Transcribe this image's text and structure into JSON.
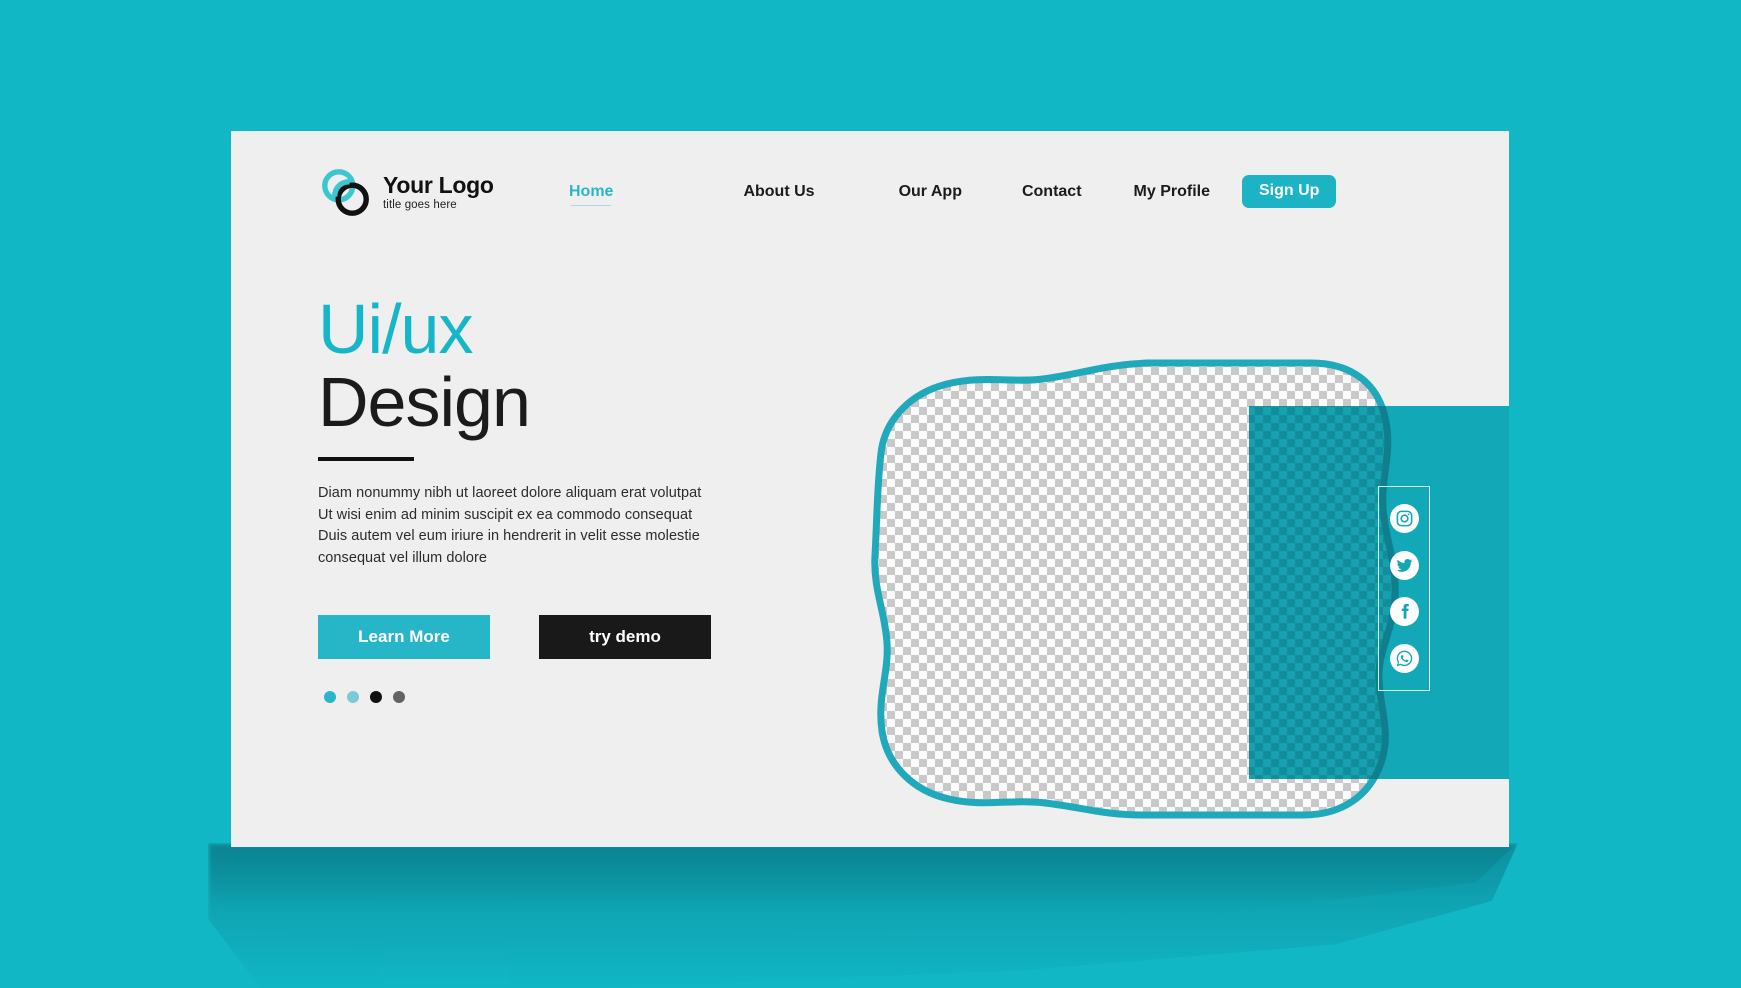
{
  "theme": {
    "page_bg": "#12b7c6",
    "card_bg": "#efefef",
    "accent": "#1cb3c4",
    "accent_light": "#2ab6c8",
    "panel_teal": "#13a8b7",
    "dark": "#191919"
  },
  "logo": {
    "title": "Your Logo",
    "tagline": "title goes here",
    "icon": "interlocking-loops-logo-icon",
    "colors": {
      "loop_teal": "#3cc6cf",
      "loop_dark": "#111111"
    }
  },
  "nav": {
    "items": [
      {
        "label": "Home",
        "active": true
      },
      {
        "label": "About Us",
        "active": false
      },
      {
        "label": "Our App",
        "active": false
      },
      {
        "label": "Contact",
        "active": false
      },
      {
        "label": "My Profile",
        "active": false
      }
    ],
    "signup_label": "Sign Up"
  },
  "hero": {
    "title_line_1": "Ui/ux",
    "title_line_2": "Design",
    "paragraph": "Diam nonummy nibh ut laoreet dolore aliquam erat volutpat\nUt wisi enim ad minim suscipit  ex ea commodo consequat\nDuis autem vel eum iriure  in hendrerit in velit esse molestie\nconsequat vel illum dolore",
    "primary_button": "Learn More",
    "secondary_button": "try demo",
    "dots": [
      {
        "color": "#2ab6c8",
        "active": true
      },
      {
        "color": "#79ccd6",
        "active": false
      },
      {
        "color": "#111111",
        "active": false
      },
      {
        "color": "#636363",
        "active": false
      }
    ]
  },
  "art": {
    "image_placeholder": "transparent-checkerboard-placeholder",
    "blob_stroke": "#1fa9bb",
    "panel": "teal-rounded-panel"
  },
  "social": {
    "items": [
      {
        "name": "instagram",
        "label": "Instagram"
      },
      {
        "name": "twitter",
        "label": "Twitter"
      },
      {
        "name": "facebook",
        "label": "Facebook"
      },
      {
        "name": "whatsapp",
        "label": "WhatsApp"
      }
    ]
  }
}
